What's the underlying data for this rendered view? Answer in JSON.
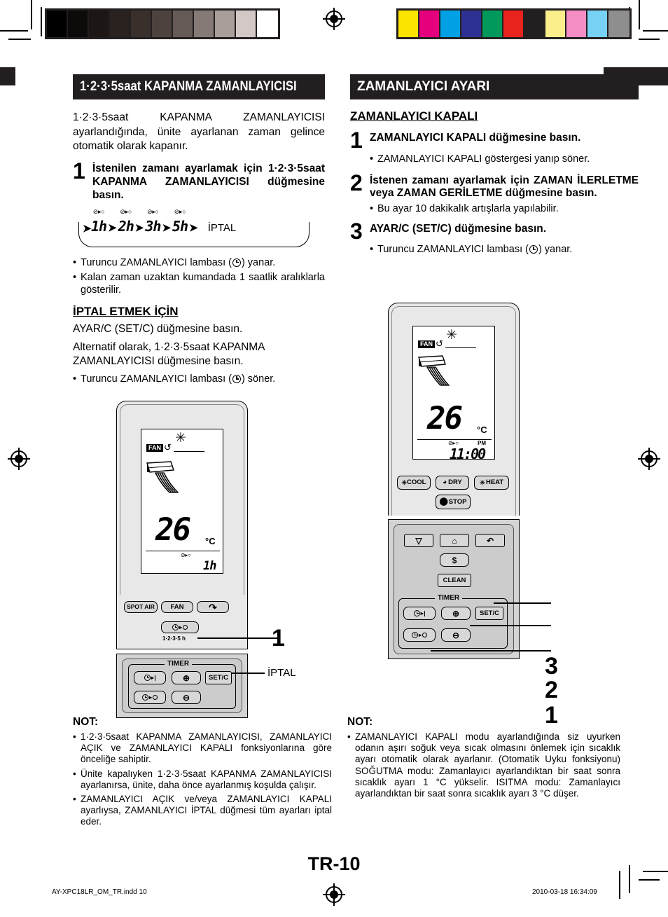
{
  "left": {
    "section_title": "1·2·3·5saat KAPANMA ZAMANLAYICISI",
    "intro": "1·2·3·5saat KAPANMA ZAMANLAYICISI ayarlandığında, ünite ayarlanan zaman gelince otomatik olarak kapanır.",
    "step1_num": "1",
    "step1_text": "İstenilen zamanı ayarlamak için 1·2·3·5saat KAPANMA ZAMANLAYICISI düğmesine basın.",
    "cycle": {
      "cap": "⊘▸○",
      "items": [
        "1h",
        "2h",
        "3h",
        "5h"
      ],
      "arrow": "➤",
      "end_label": "İPTAL",
      "lead_arrow": "➤"
    },
    "bullet1_a": "Turuncu ZAMANLAYICI lambası (",
    "bullet1_b": ") yanar.",
    "bullet2": "Kalan zaman uzaktan kumandada 1 saatlik aralıklarla gösterilir.",
    "cancel_head": "İPTAL ETMEK İÇİN",
    "cancel_p1": "AYAR/C (SET/C) düğmesine basın.",
    "cancel_p2": "Alternatif olarak, 1·2·3·5saat KAPANMA ZAMANLAYICISI düğmesine basın.",
    "cancel_bullet_a": "Turuncu ZAMANLAYICI lambası (",
    "cancel_bullet_b": ") söner.",
    "remote": {
      "lcd": {
        "snowflake": "✳",
        "fan_label": "FAN",
        "swirl": "↺",
        "temp": "26",
        "degree": "°C",
        "timer_mark": "⊘▸○",
        "hours": "1h"
      },
      "keys": {
        "spot_air": "SPOT AIR",
        "fan": "FAN",
        "swing": "↷",
        "timer_off_sub": "1·2·3·5 h",
        "timer_group": "TIMER",
        "set_c": "SET/C",
        "plus": "⊕",
        "minus": "⊖"
      },
      "callout_1": "1",
      "callout_iptal": "İPTAL"
    },
    "note_title": "NOT:",
    "notes": [
      "1·2·3·5saat KAPANMA ZAMANLAYICISI, ZAMANLAYICI AÇIK ve ZAMANLAYICI KAPALI fonksiyonlarına göre önceliğe sahiptir.",
      "Ünite kapalıyken 1·2·3·5saat KAPANMA ZAMANLAYICISI ayarlanırsa, ünite, daha önce ayarlanmış koşulda çalışır.",
      "ZAMANLAYICI AÇIK ve/veya ZAMANLAYICI KAPALI ayarlıysa, ZAMANLAYICI İPTAL düğmesi tüm ayarları iptal eder."
    ]
  },
  "right": {
    "section_title": "ZAMANLAYICI AYARI",
    "sub_head": "ZAMANLAYICI KAPALI",
    "step1_num": "1",
    "step1_text": "ZAMANLAYICI KAPALI düğmesine basın.",
    "step1_bullet": "ZAMANLAYICI KAPALI göstergesi yanıp söner.",
    "step2_num": "2",
    "step2_text": "İstenen zamanı ayarlamak için ZAMAN İLERLETME veya ZAMAN GERİLETME düğmesine basın.",
    "step2_bullet": "Bu ayar 10 dakikalık artışlarla yapılabilir.",
    "step3_num": "3",
    "step3_text": "AYAR/C (SET/C) düğmesine basın.",
    "step3_bullet_a": "Turuncu ZAMANLAYICI lambası (",
    "step3_bullet_b": ") yanar.",
    "remote": {
      "lcd": {
        "snowflake": "✳",
        "fan_label": "FAN",
        "swirl": "↺",
        "temp": "26",
        "degree": "°C",
        "timer_mark": "⊘▸○",
        "pm": "PM",
        "clock": "11:00"
      },
      "keys": {
        "cool": "COOL",
        "dry": "DRY",
        "heat": "HEAT",
        "stop": "STOP",
        "coin": "$",
        "clean": "CLEAN",
        "timer_group": "TIMER",
        "set_c": "SET/C",
        "plus": "⊕",
        "minus": "⊖"
      },
      "callout_3": "3",
      "callout_2": "2",
      "callout_1": "1"
    },
    "note_title": "NOT:",
    "notes": [
      "ZAMANLAYICI KAPALI modu ayarlandığında siz uyurken odanın aşırı soğuk veya sıcak olmasını önlemek için sıcaklık ayarı otomatik olarak ayarlanır. (Otomatik Uyku fonksiyonu) SOĞUTMA modu: Zamanlayıcı ayarlandıktan bir saat sonra sıcaklık ayarı 1 °C yükselir. ISITMA modu: Zamanlayıcı ayarlandıktan bir saat sonra sıcaklık ayarı 3 °C düşer."
    ]
  },
  "footer": {
    "page_number": "TR-10",
    "file_name": "AY-XPC18LR_OM_TR.indd   10",
    "timestamp": "2010-03-18   16:34:09"
  },
  "calibration": {
    "gray_swatches": [
      "#000000",
      "#0d0a0a",
      "#1c1715",
      "#29221f",
      "#39302c",
      "#4e423e",
      "#665a56",
      "#857a75",
      "#a89e9a",
      "#d3c8c5",
      "#ffffff"
    ],
    "cmyk_swatches": [
      "#fbe500",
      "#e5007e",
      "#00a0e5",
      "#2e3192",
      "#00995b",
      "#e8221c",
      "#231f20",
      "#faef8a",
      "#f58ec4",
      "#78d2f5",
      "#8e8e8e"
    ]
  }
}
